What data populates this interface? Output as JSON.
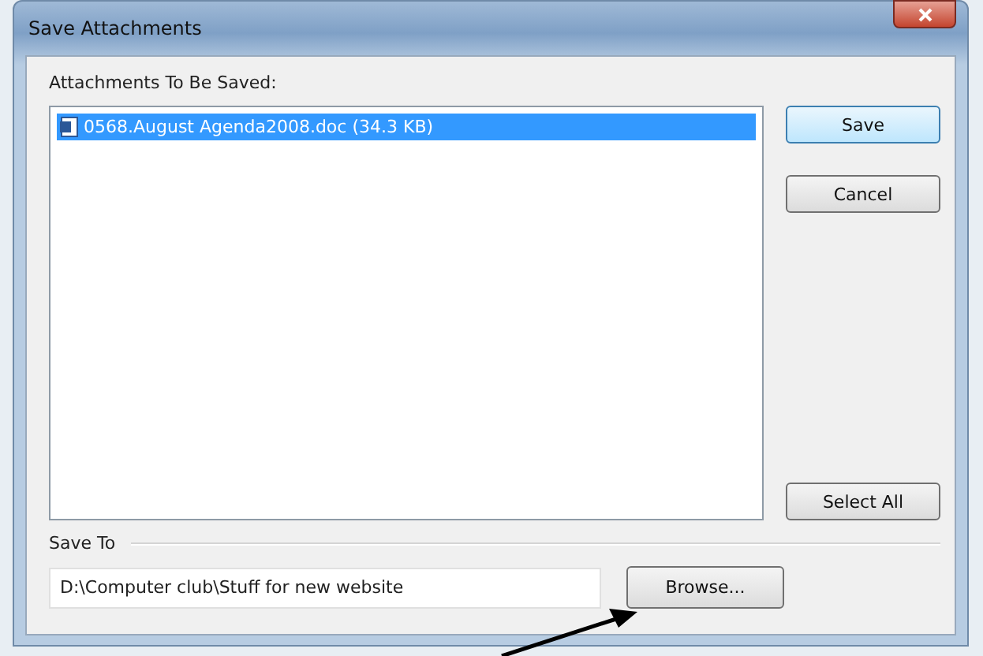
{
  "window": {
    "title": "Save Attachments"
  },
  "attachments": {
    "label": "Attachments To Be Saved:",
    "items": [
      {
        "name": "0568.August Agenda2008.doc (34.3 KB)",
        "selected": true
      }
    ]
  },
  "buttons": {
    "save": "Save",
    "cancel": "Cancel",
    "select_all": "Select All"
  },
  "save_to": {
    "label": "Save To",
    "value": "D:\\Computer club\\Stuff for new website",
    "browse": "Browse..."
  }
}
